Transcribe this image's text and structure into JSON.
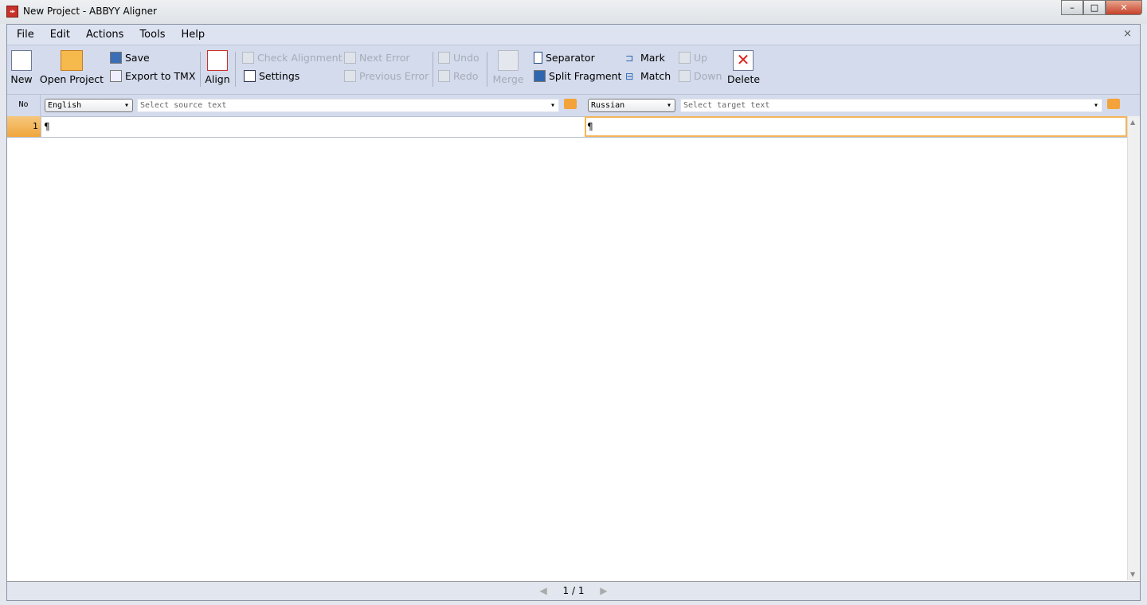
{
  "window": {
    "title": "New Project - ABBYY Aligner",
    "minimize": "–",
    "maximize": "□",
    "close": "✕"
  },
  "menu": [
    "File",
    "Edit",
    "Actions",
    "Tools",
    "Help"
  ],
  "menu_close": "×",
  "toolbar": {
    "new": "New",
    "open_project": "Open Project",
    "save": "Save",
    "export_tmx": "Export to TMX",
    "align": "Align",
    "check_alignment": "Check Alignment",
    "settings": "Settings",
    "next_error": "Next Error",
    "previous_error": "Previous Error",
    "undo": "Undo",
    "redo": "Redo",
    "merge": "Merge",
    "separator": "Separator",
    "split_fragment": "Split Fragment",
    "mark": "Mark",
    "match": "Match",
    "up": "Up",
    "down": "Down",
    "delete": "Delete"
  },
  "header": {
    "no": "No",
    "source_language": "English",
    "source_placeholder": "Select source text",
    "target_language": "Russian",
    "target_placeholder": "Select target text"
  },
  "rows": [
    {
      "no": "1",
      "source": "¶",
      "target": "¶"
    }
  ],
  "status": {
    "page": "1 / 1"
  }
}
